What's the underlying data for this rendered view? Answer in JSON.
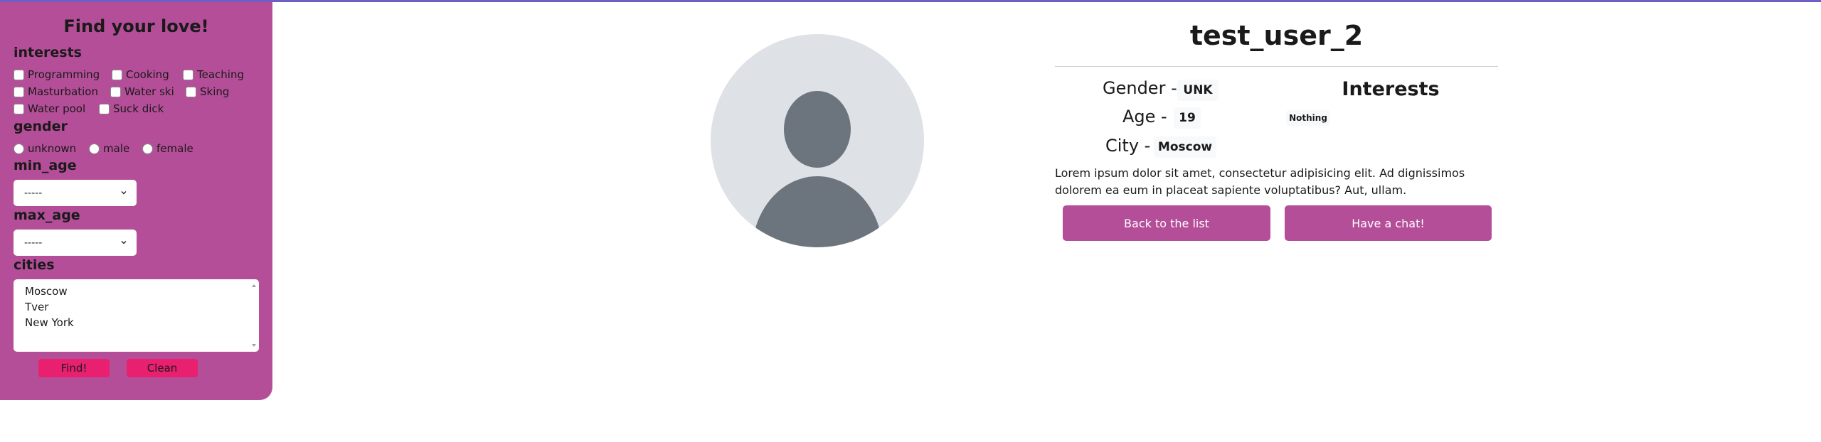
{
  "colors": {
    "sidebar_bg": "#b44e98",
    "pink_button": "#e8206f",
    "main_button": "#b44e98",
    "top_border": "#6f5fc4"
  },
  "sidebar": {
    "title": "Find your love!",
    "interests_label": "interests",
    "interests": [
      "Programming",
      "Cooking",
      "Teaching",
      "Masturbation",
      "Water ski",
      "Sking",
      "Water pool",
      "Suck dick"
    ],
    "gender_label": "gender",
    "genders": [
      "unknown",
      "male",
      "female"
    ],
    "min_age_label": "min_age",
    "min_age_value": "-----",
    "max_age_label": "max_age",
    "max_age_value": "-----",
    "cities_label": "cities",
    "cities": [
      "Moscow",
      "Tver",
      "New York"
    ],
    "find_label": "Find!",
    "clean_label": "Clean"
  },
  "profile": {
    "username": "test_user_2",
    "gender_label": "Gender -",
    "gender_value": "UNK",
    "age_label": "Age -",
    "age_value": "19",
    "city_label": "City -",
    "city_value": "Moscow",
    "interests_title": "Interests",
    "interests_value": "Nothing",
    "about": "Lorem ipsum dolor sit amet, consectetur adipisicing elit. Ad dignissimos dolorem ea eum in placeat sapiente voluptatibus? Aut, ullam.",
    "back_label": "Back to the list",
    "chat_label": "Have a chat!"
  }
}
